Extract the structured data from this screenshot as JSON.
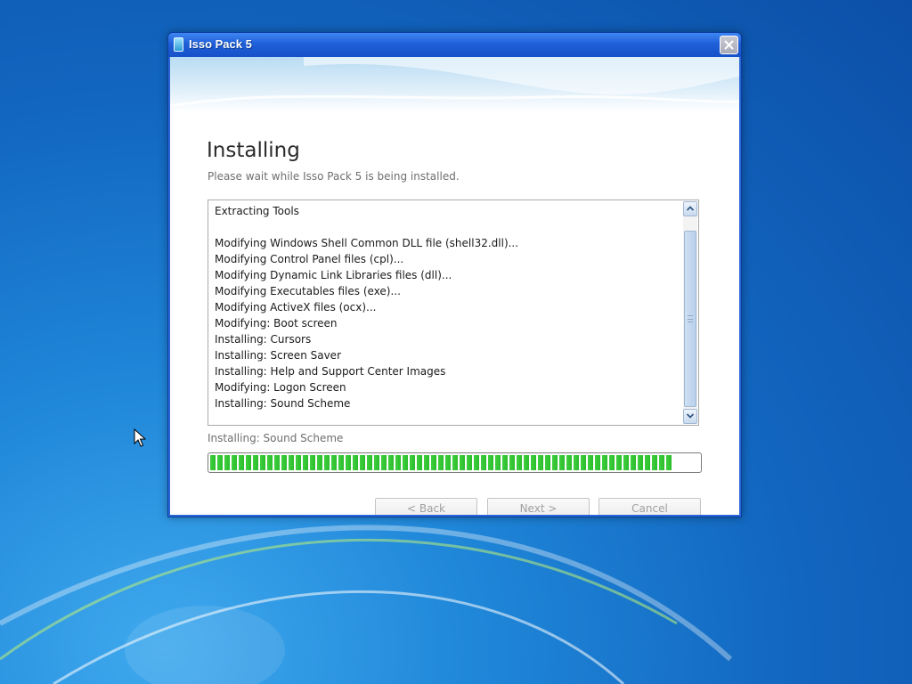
{
  "window": {
    "title": "Isso Pack 5",
    "heading": "Installing",
    "subheading": "Please wait while Isso Pack 5 is being installed."
  },
  "log": {
    "lines": [
      "Extracting Tools",
      "",
      "Modifying Windows Shell Common DLL file (shell32.dll)...",
      "Modifying Control Panel files (cpl)...",
      "Modifying Dynamic Link Libraries files (dll)...",
      "Modifying Executables files (exe)...",
      "Modifying ActiveX files (ocx)...",
      "Modifying: Boot screen",
      "Installing: Cursors",
      "Installing: Screen Saver",
      "Installing: Help and Support Center Images",
      "Modifying: Logon Screen",
      "Installing: Sound Scheme"
    ]
  },
  "status": {
    "text": "Installing: Sound Scheme",
    "progress_fraction": 0.945
  },
  "buttons": {
    "back": "< Back",
    "next": "Next >",
    "cancel": "Cancel"
  },
  "colors": {
    "titlebar": "#1f5fd8",
    "progress": "#33c633",
    "desktop": "#1a7ad0"
  }
}
